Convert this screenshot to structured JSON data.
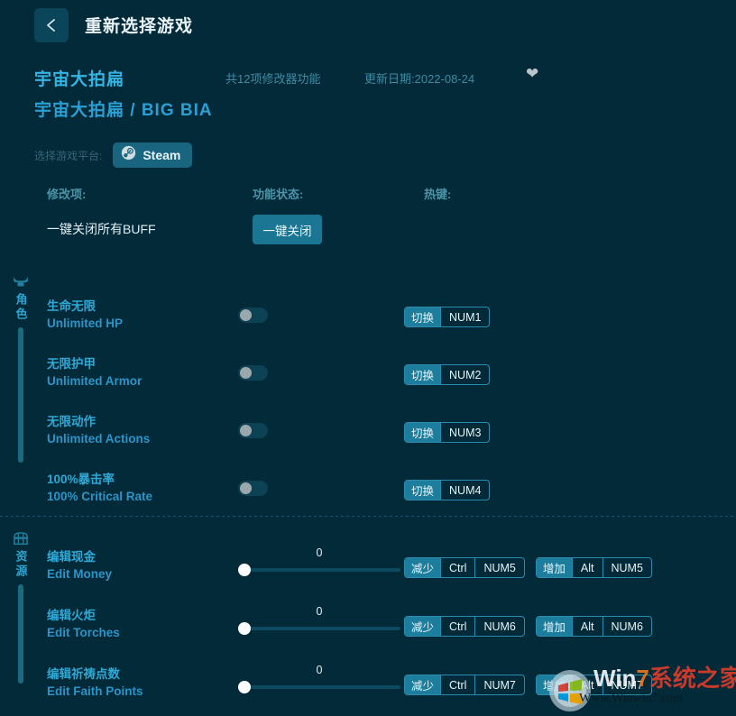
{
  "topbar": {
    "back_icon": "chevron-left-icon",
    "title": "重新选择游戏"
  },
  "game": {
    "title_cn": "宇宙大拍扁",
    "title_full": "宇宙大拍扁 / BIG BIA",
    "feature_count": "共12项修改器功能",
    "update_date": "更新日期:2022-08-24",
    "favorite_icon": "heart-icon"
  },
  "platform": {
    "label": "选择游戏平台:",
    "selected": "Steam",
    "icon": "steam-icon"
  },
  "columns": {
    "mod": "修改项:",
    "status": "功能状态:",
    "hotkey": "热键:"
  },
  "global_buff": {
    "label": "一键关闭所有BUFF",
    "button": "一键关闭"
  },
  "sections": [
    {
      "name": "角色",
      "icon": "character-helmet-icon",
      "rows": [
        {
          "cn": "生命无限",
          "en": "Unlimited HP",
          "control": "toggle",
          "value": "off",
          "keys": [
            {
              "action": "切换",
              "combo": [
                "NUM1"
              ]
            }
          ]
        },
        {
          "cn": "无限护甲",
          "en": "Unlimited Armor",
          "control": "toggle",
          "value": "off",
          "keys": [
            {
              "action": "切换",
              "combo": [
                "NUM2"
              ]
            }
          ]
        },
        {
          "cn": "无限动作",
          "en": "Unlimited Actions",
          "control": "toggle",
          "value": "off",
          "keys": [
            {
              "action": "切换",
              "combo": [
                "NUM3"
              ]
            }
          ]
        },
        {
          "cn": "100%暴击率",
          "en": "100% Critical Rate",
          "control": "toggle",
          "value": "off",
          "keys": [
            {
              "action": "切换",
              "combo": [
                "NUM4"
              ]
            }
          ]
        }
      ]
    },
    {
      "name": "资源",
      "icon": "treasure-chest-icon",
      "rows": [
        {
          "cn": "编辑现金",
          "en": "Edit Money",
          "control": "slider",
          "value": "0",
          "keys": [
            {
              "action": "减少",
              "combo": [
                "Ctrl",
                "NUM5"
              ]
            },
            {
              "action": "增加",
              "combo": [
                "Alt",
                "NUM5"
              ]
            }
          ]
        },
        {
          "cn": "编辑火炬",
          "en": "Edit Torches",
          "control": "slider",
          "value": "0",
          "keys": [
            {
              "action": "减少",
              "combo": [
                "Ctrl",
                "NUM6"
              ]
            },
            {
              "action": "增加",
              "combo": [
                "Alt",
                "NUM6"
              ]
            }
          ]
        },
        {
          "cn": "编辑祈祷点数",
          "en": "Edit Faith Points",
          "control": "slider",
          "value": "0",
          "keys": [
            {
              "action": "减少",
              "combo": [
                "Ctrl",
                "NUM7"
              ]
            },
            {
              "action": "增加",
              "combo": [
                "Alt",
                "NUM7"
              ]
            }
          ]
        }
      ]
    }
  ],
  "watermark": {
    "brand_w": "W",
    "brand_in": "in",
    "brand_7": "7",
    "brand_cn": "系统之家",
    "url": "Www.Winwin7.com",
    "logo": "windows-logo-icon"
  },
  "colors": {
    "background": "#022a38",
    "accent": "#1d7d9c",
    "title_accent": "#35b4e4",
    "label_muted": "#3f8ba3"
  }
}
